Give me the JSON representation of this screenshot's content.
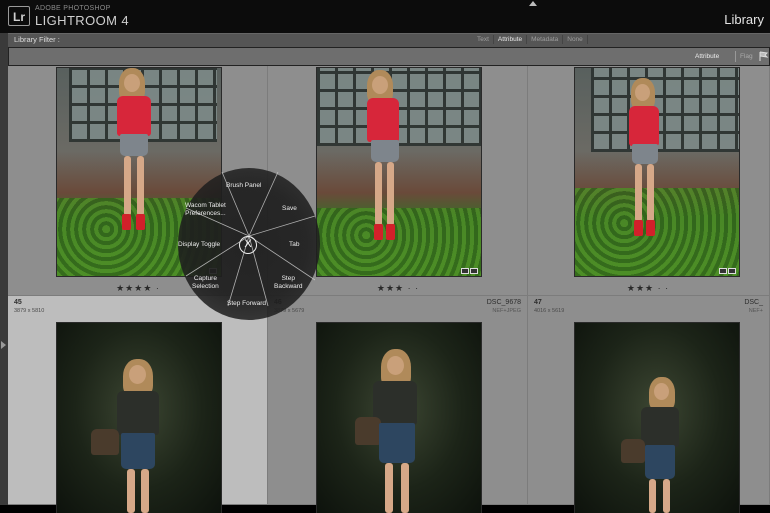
{
  "header": {
    "vendor": "ADOBE PHOTOSHOP",
    "app_name": "LIGHTROOM 4",
    "logo_text": "Lr",
    "module_title": "Library"
  },
  "filter_bar": {
    "label": "Library Filter :",
    "tabs": [
      {
        "label": "Text",
        "active": false
      },
      {
        "label": "Attribute",
        "active": true
      },
      {
        "label": "Metadata",
        "active": false
      },
      {
        "label": "None",
        "active": false
      }
    ]
  },
  "attribute_bar": {
    "label": "Attribute",
    "flag_label": "Flag",
    "flag_icon": "flag-icon"
  },
  "grid": {
    "cells": [
      {
        "index": "",
        "dims": "",
        "file": "",
        "format": "",
        "stars": "★★★★ ·",
        "selected": false,
        "style": "day"
      },
      {
        "index": "",
        "dims": "",
        "file": "",
        "format": "",
        "stars": "★★★ · ·",
        "selected": false,
        "style": "day"
      },
      {
        "index": "",
        "dims": "",
        "file": "",
        "format": "",
        "stars": "★★★ · ·",
        "selected": false,
        "style": "day"
      },
      {
        "index": "45",
        "dims": "3879 x 5810",
        "file": "",
        "format": "",
        "stars": "",
        "selected": true,
        "style": "night"
      },
      {
        "index": "46",
        "dims": "3879 x 5679",
        "file": "DSC_9678",
        "format": "NEF+JPEG",
        "stars": "",
        "selected": false,
        "style": "night"
      },
      {
        "index": "47",
        "dims": "4016 x 5619",
        "file": "DSC_",
        "format": "NEF+",
        "stars": "",
        "selected": false,
        "style": "night"
      }
    ]
  },
  "radial_menu": {
    "center_label": "X",
    "items": {
      "brush_panel": "Brush Panel",
      "wacom_line1": "Wacom Tablet",
      "wacom_line2": "Preferences...",
      "save": "Save",
      "display_toggle": "Display Toggle",
      "tab": "Tab",
      "capture_line1": "Capture",
      "capture_line2": "Selection",
      "step_backward_line1": "Step",
      "step_backward_line2": "Backward",
      "step_forward": "Step Forward"
    }
  }
}
